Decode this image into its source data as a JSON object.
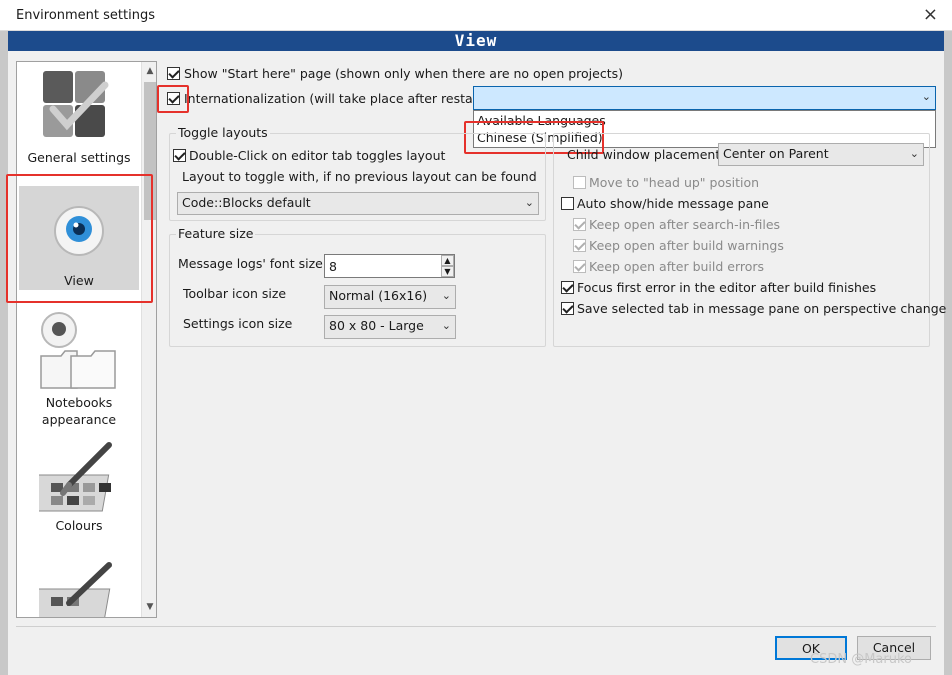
{
  "window": {
    "title": "Environment settings",
    "close_glyph": "×",
    "banner": "View"
  },
  "sidebar": {
    "items": [
      {
        "label": "General settings",
        "icon": "general-settings-icon"
      },
      {
        "label": "View",
        "icon": "eye-icon"
      },
      {
        "label": "Notebooks",
        "label2": "appearance",
        "icon": "notebooks-icon"
      },
      {
        "label": "Colours",
        "icon": "palette-icon"
      },
      {
        "label": "",
        "icon": "palette-icon"
      }
    ],
    "scroll_up": "▲",
    "scroll_down": "▼"
  },
  "main": {
    "show_start_here": {
      "label": "Show \"Start here\" page (shown only when there are no open projects)",
      "checked": true
    },
    "internationalization": {
      "label": "Internationalization (will take place after restart)",
      "checked": true
    },
    "language_dropdown": {
      "value": "",
      "options": [
        "Available Languages",
        "Chinese (Simplified)"
      ]
    },
    "toggle_layouts": {
      "title": "Toggle layouts",
      "double_click_label": "Double-Click on editor tab toggles layout",
      "double_click_checked": true,
      "layout_label": "Layout to toggle with, if no previous layout can be found",
      "layout_value": "Code::Blocks default"
    },
    "feature_size": {
      "title": "Feature size",
      "message_logs_label": "Message logs' font size:",
      "message_logs_value": "8",
      "toolbar_label": "Toolbar icon size",
      "toolbar_value": "Normal (16x16)",
      "settings_label": "Settings icon size",
      "settings_value": "80 x 80 - Large"
    },
    "right_panel": {
      "child_window_label": "Child window placement",
      "child_window_value": "Center on Parent",
      "move_head_up": {
        "label": "Move to \"head up\" position",
        "checked": false
      },
      "auto_show": {
        "label": "Auto show/hide message pane",
        "checked": false
      },
      "keep_open_search": {
        "label": "Keep open after search-in-files",
        "checked": true
      },
      "keep_open_warnings": {
        "label": "Keep open after build warnings",
        "checked": true
      },
      "keep_open_errors": {
        "label": "Keep open after build errors",
        "checked": true
      },
      "focus_first_error": {
        "label": "Focus first error in the editor after build finishes",
        "checked": true
      },
      "save_selected_tab": {
        "label": "Save selected tab in message pane on perspective change",
        "checked": true
      }
    }
  },
  "footer": {
    "ok_label": "OK",
    "cancel_label": "Cancel",
    "watermark": "CSDN @Maruko"
  },
  "colors": {
    "banner": "#1c4b8c",
    "highlight": "#e5312b",
    "dropdown_focus": "#cde8ff"
  }
}
